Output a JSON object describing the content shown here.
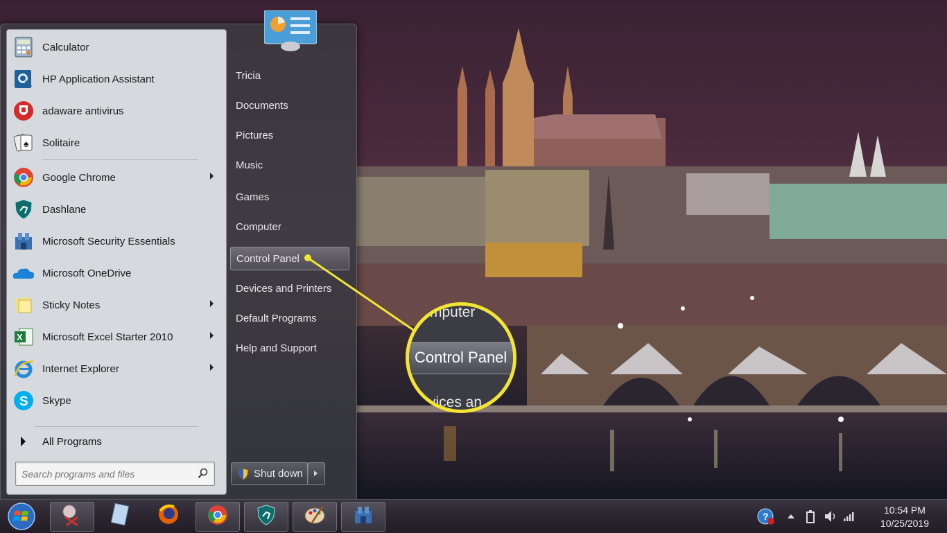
{
  "start_menu": {
    "programs": [
      {
        "label": "Calculator",
        "icon": "calculator-icon",
        "submenu": false
      },
      {
        "label": "HP Application Assistant",
        "icon": "hp-assistant-icon",
        "submenu": false
      },
      {
        "label": "adaware antivirus",
        "icon": "adaware-icon",
        "submenu": false
      },
      {
        "label": "Solitaire",
        "icon": "solitaire-icon",
        "submenu": false
      },
      {
        "label": "Google Chrome",
        "icon": "chrome-icon",
        "submenu": true
      },
      {
        "label": "Dashlane",
        "icon": "dashlane-icon",
        "submenu": false
      },
      {
        "label": "Microsoft Security Essentials",
        "icon": "security-essentials-icon",
        "submenu": false
      },
      {
        "label": "Microsoft OneDrive",
        "icon": "onedrive-icon",
        "submenu": false
      },
      {
        "label": "Sticky Notes",
        "icon": "sticky-notes-icon",
        "submenu": true
      },
      {
        "label": "Microsoft Excel Starter 2010",
        "icon": "excel-icon",
        "submenu": true
      },
      {
        "label": "Internet Explorer",
        "icon": "internet-explorer-icon",
        "submenu": true
      },
      {
        "label": "Skype",
        "icon": "skype-icon",
        "submenu": false
      }
    ],
    "all_programs": "All Programs",
    "search_placeholder": "Search programs and files",
    "places": [
      {
        "label": "Tricia"
      },
      {
        "label": "Documents"
      },
      {
        "label": "Pictures"
      },
      {
        "label": "Music"
      },
      {
        "label": "Games"
      },
      {
        "label": "Computer"
      },
      {
        "label": "Control Panel",
        "highlighted": true
      },
      {
        "label": "Devices and Printers"
      },
      {
        "label": "Default Programs"
      },
      {
        "label": "Help and Support"
      }
    ],
    "shutdown_label": "Shut down"
  },
  "callout": {
    "top_text": "mputer",
    "label": "Control Panel",
    "bottom_text": "vices an",
    "color": "#f2e534"
  },
  "taskbar": {
    "pinned": [
      "snipping-tool-icon",
      "notepad-icon",
      "firefox-icon",
      "chrome-icon",
      "dashlane-icon",
      "paint-icon",
      "security-essentials-icon"
    ],
    "time": "10:54 PM",
    "date": "10/25/2019"
  }
}
